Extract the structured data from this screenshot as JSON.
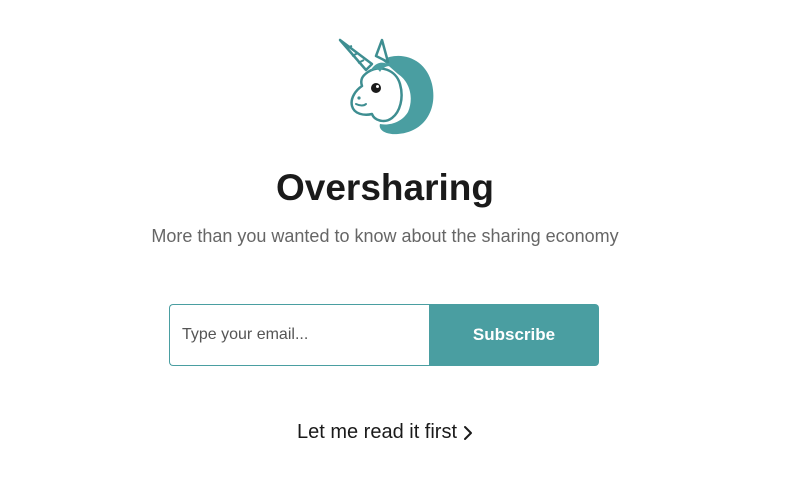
{
  "brand": {
    "accent_color": "#4a9ea1",
    "logo_icon": "unicorn-icon"
  },
  "header": {
    "title": "Oversharing",
    "subtitle": "More than you wanted to know about the sharing economy"
  },
  "signup": {
    "email_placeholder": "Type your email...",
    "email_value": "",
    "subscribe_label": "Subscribe"
  },
  "footer_link": {
    "label": "Let me read it first",
    "icon": "chevron-right-icon"
  }
}
